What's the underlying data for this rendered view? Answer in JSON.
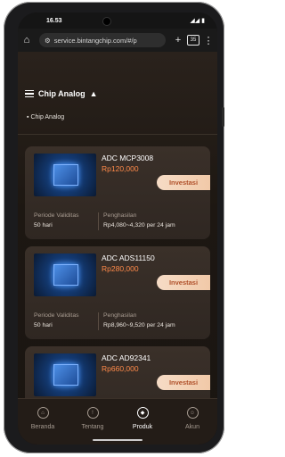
{
  "status": {
    "time": "16.53"
  },
  "browser": {
    "url": "service.bintangchip.com/#/p",
    "tabs": "35"
  },
  "header": {
    "title": "Chip Analog",
    "breadcrumb": "Chip Analog"
  },
  "cards": [
    {
      "name": "ADC MCP3008",
      "price": "Rp120,000",
      "button": "Investasi",
      "period_label": "Periode Validitas",
      "period": "50 hari",
      "income_label": "Penghasilan",
      "income": "Rp4,080~4,320 per 24 jam"
    },
    {
      "name": "ADC ADS11150",
      "price": "Rp280,000",
      "button": "Investasi",
      "period_label": "Periode Validitas",
      "period": "50 hari",
      "income_label": "Penghasilan",
      "income": "Rp8,960~9,520 per 24 jam"
    },
    {
      "name": "ADC AD92341",
      "price": "Rp660,000",
      "button": "Investasi"
    }
  ],
  "nav": [
    {
      "label": "Beranda",
      "icon": "home-icon"
    },
    {
      "label": "Tentang",
      "icon": "info-icon"
    },
    {
      "label": "Produk",
      "icon": "box-icon"
    },
    {
      "label": "Akun",
      "icon": "user-icon"
    }
  ]
}
